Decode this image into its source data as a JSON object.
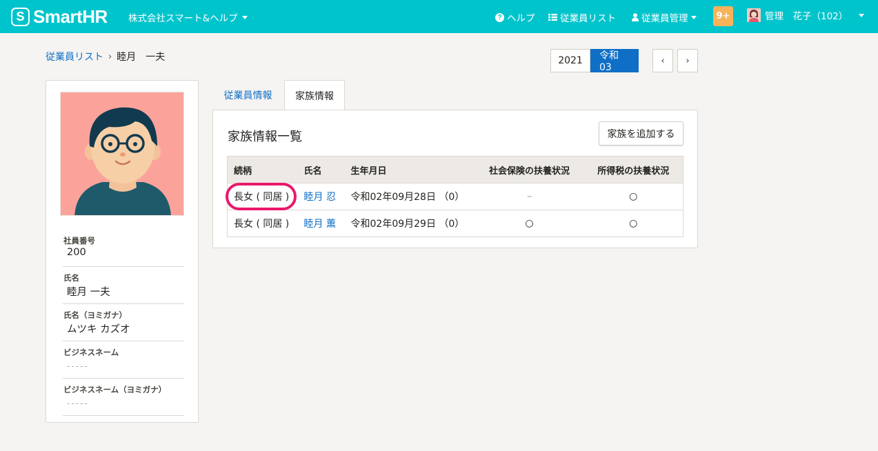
{
  "brand": {
    "color": "#00c4cc",
    "logo_text": "SmartHR",
    "logo_mark": "S"
  },
  "header": {
    "company": "株式会社スマート&ヘルプ",
    "help": "ヘルプ",
    "employee_list": "従業員リスト",
    "employee_management": "従業員管理",
    "notifications": "9+",
    "user": "管理　花子（102）"
  },
  "breadcrumb": {
    "parent": "従業員リスト",
    "current": "睦月　一夫"
  },
  "year_selector": {
    "western": "2021",
    "japanese": "令和03"
  },
  "profile": {
    "fields": [
      {
        "label": "社員番号",
        "value": "200"
      },
      {
        "label": "氏名",
        "value": "睦月 一夫"
      },
      {
        "label": "氏名（ヨミガナ）",
        "value": "ムツキ カズオ"
      },
      {
        "label": "ビジネスネーム",
        "value": "-----"
      },
      {
        "label": "ビジネスネーム（ヨミガナ）",
        "value": "-----"
      }
    ]
  },
  "tabs": [
    {
      "label": "従業員情報",
      "active": false
    },
    {
      "label": "家族情報",
      "active": true
    }
  ],
  "family": {
    "title": "家族情報一覧",
    "add_button": "家族を追加する",
    "columns": [
      "続柄",
      "氏名",
      "生年月日",
      "社会保険の扶養状況",
      "所得税の扶養状況"
    ],
    "rows": [
      {
        "relation": "長女 ( 同居 )",
        "name": "睦月 忍",
        "birth": "令和02年09月28日 （0）",
        "social": "–",
        "tax": "○"
      },
      {
        "relation": "長女 ( 同居 )",
        "name": "睦月 薫",
        "birth": "令和02年09月29日 （0）",
        "social": "○",
        "tax": "○"
      }
    ]
  },
  "colors": {
    "link": "#0f6fc6",
    "highlight": "#e8196b",
    "notification": "#f8b35a"
  }
}
